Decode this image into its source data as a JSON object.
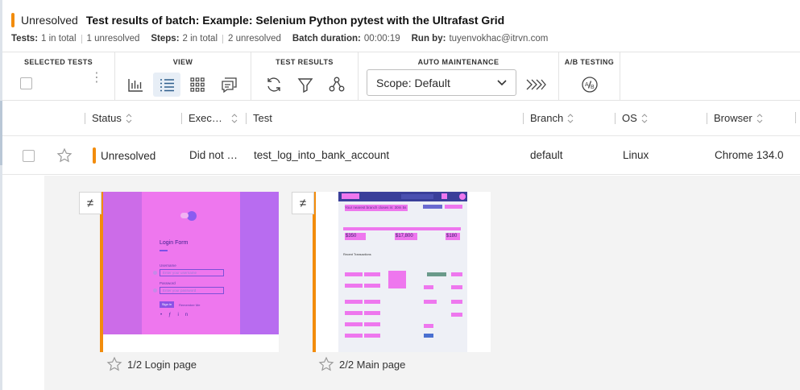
{
  "header": {
    "status": "Unresolved",
    "title": "Test results of batch:  Example: Selenium Python pytest with the Ultrafast Grid",
    "meta": {
      "tests_label": "Tests:",
      "tests_total": "1 in total",
      "tests_unresolved": "1 unresolved",
      "steps_label": "Steps:",
      "steps_total": "2 in total",
      "steps_unresolved": "2 unresolved",
      "duration_label": "Batch duration:",
      "duration_value": "00:00:19",
      "runby_label": "Run by:",
      "runby_value": "tuyenvokhac@itrvn.com"
    }
  },
  "toolbar": {
    "selected_tests": "SELECTED TESTS",
    "view": "VIEW",
    "test_results": "TEST RESULTS",
    "auto_maintenance": "AUTO MAINTENANCE",
    "ab_testing": "A/B TESTING",
    "scope_value": "Scope: Default",
    "icons": [
      "bar-chart-icon",
      "list-view-icon",
      "grid-view-icon",
      "comments-view-icon",
      "refresh-icon",
      "filter-icon",
      "group-by-icon",
      "chevron-down-icon",
      "auto-maintenance-icon",
      "ab-testing-icon"
    ]
  },
  "table": {
    "columns": [
      "Status",
      "Exec…",
      "Test",
      "Branch",
      "OS",
      "Browser"
    ],
    "rows": [
      {
        "status": "Unresolved",
        "execution": "Did not …",
        "test": "test_log_into_bank_account",
        "branch": "default",
        "os": "Linux",
        "browser": "Chrome 134.0"
      }
    ]
  },
  "steps": [
    {
      "label": "1/2 Login page",
      "diff_symbol": "≠",
      "screen": {
        "form_title": "Login Form",
        "username_label": "Username",
        "username_placeholder": "Enter your username",
        "password_label": "Password",
        "password_placeholder": "Enter your password",
        "signin": "Sign in",
        "remember": "Remember Me"
      }
    },
    {
      "label": "2/2 Main page",
      "diff_symbol": "≠",
      "screen": {
        "banner": "Your nearest branch closes in: 30m 5s",
        "balances": [
          "$350",
          "$17,800",
          "$180"
        ],
        "section": "Recent Transactions"
      }
    }
  ],
  "colors": {
    "unresolved": "#f28c0c",
    "diff_magenta": "#f07cf0",
    "diff_purple": "#b76cf2"
  }
}
